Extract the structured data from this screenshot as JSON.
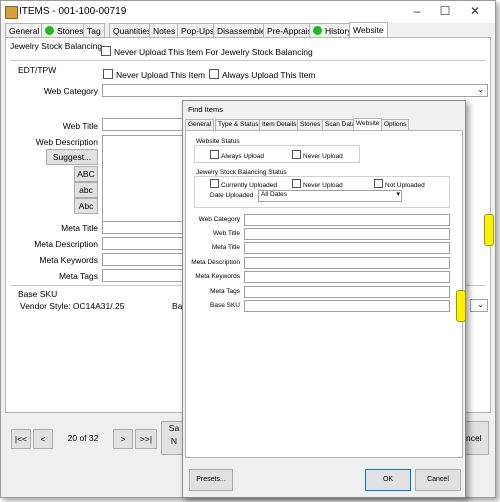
{
  "window": {
    "title": "ITEMS - 001-100-00719",
    "minimize": "–",
    "maximize": "☐",
    "close": "✕"
  },
  "tabs": [
    {
      "label": "General",
      "dot": false
    },
    {
      "label": "Stones",
      "dot": true
    },
    {
      "label": "Tag",
      "dot": false
    },
    {
      "label": "Quantities",
      "dot": false
    },
    {
      "label": "Notes",
      "dot": false
    },
    {
      "label": "Pop-Ups",
      "dot": false
    },
    {
      "label": "Disassembled",
      "dot": false
    },
    {
      "label": "Pre-Appraise",
      "dot": false
    },
    {
      "label": "History",
      "dot": true
    },
    {
      "label": "Website",
      "dot": false
    }
  ],
  "main": {
    "jewelry_balancing_label": "Jewelry Stock Balancing",
    "never_upload_balancing": "Never Upload This Item For Jewelry Stock Balancing",
    "edt_section": "EDT/TPW",
    "never_upload_item": "Never Upload This Item",
    "always_upload_item": "Always Upload This Item",
    "web_category": "Web Category",
    "web_title": "Web Title",
    "web_description": "Web Description",
    "suggest": "Suggest...",
    "abc_upper": "ABC",
    "abc_lower": "abc",
    "abc_title": "Abc",
    "meta_title": "Meta Title",
    "meta_description": "Meta Description",
    "meta_keywords": "Meta Keywords",
    "meta_tags": "Meta Tags",
    "base_sku_section": "Base SKU",
    "vendor_style": "Vendor Style: OC14A31/.25",
    "base_truncated": "Ba"
  },
  "bottom": {
    "first": "|<<",
    "prev": "<",
    "record": "20 of 32",
    "next": ">",
    "last": ">>|",
    "save_partial_1": "Sa",
    "save_partial_2": "N",
    "cancel_partial": "ncel"
  },
  "find_dialog": {
    "title": "Find Items",
    "tabs": [
      "General",
      "Type & Status",
      "Item Details",
      "Stones",
      "Scan Data",
      "Website",
      "Options"
    ],
    "selected_tab": "Website",
    "website_status": "Website Status",
    "always_upload": "Always Upload",
    "never_upload": "Never Upload",
    "jsb_status": "Jewelry Stock Balancing Status",
    "currently_uploaded": "Currently Uploaded",
    "never_upload2": "Never Upload",
    "not_uploaded": "Not Uploaded",
    "date_uploaded": "Date Uploaded",
    "date_value": "All Dates",
    "fields": [
      "Web Category",
      "Web Title",
      "Meta Title",
      "Meta Description",
      "Meta Keywords",
      "Meta Tags",
      "Base SKU"
    ],
    "presets": "Presets...",
    "ok": "OK",
    "cancel": "Cancel"
  },
  "colors": {
    "green_dot": "#1fba1f",
    "yellow_tab": "#fff200",
    "window_bg": "#f0f0f0"
  }
}
